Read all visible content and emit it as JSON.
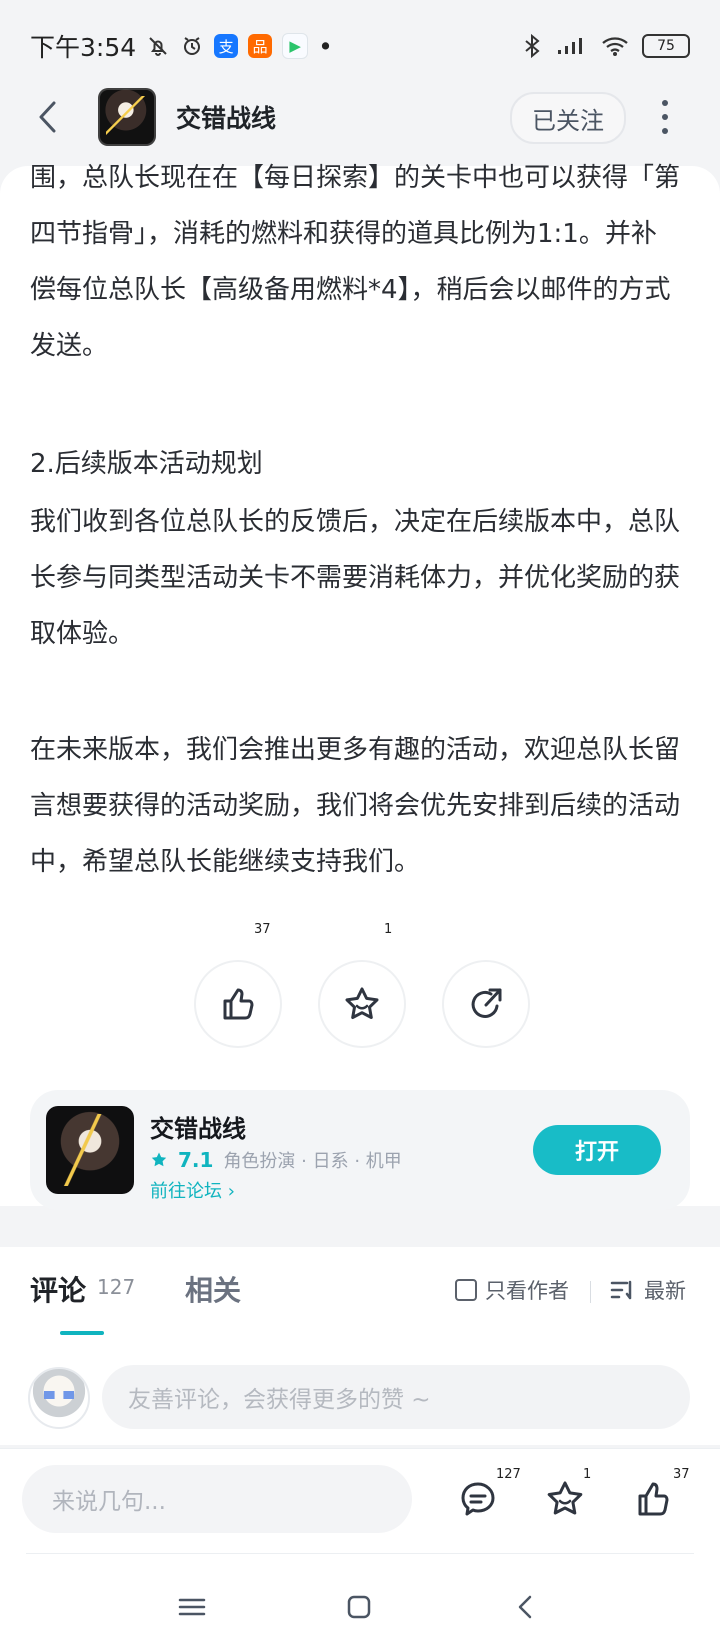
{
  "status": {
    "time": "下午3:54",
    "battery": "75",
    "app_icons": [
      "alipay-icon",
      "taobao-icon",
      "video-app-icon"
    ]
  },
  "header": {
    "title": "交错战线",
    "follow_label": "已关注"
  },
  "article": {
    "paragraph_1": "围，总队长现在在【每日探索】的关卡中也可以获得「第四节指骨」，消耗的燃料和获得的道具比例为1:1。并补偿每位总队长【高级备用燃料*4】，稍后会以邮件的方式发送。",
    "heading_2": "2.后续版本活动规划",
    "paragraph_2": "我们收到各位总队长的反馈后，决定在后续版本中，总队长参与同类型活动关卡不需要消耗体力，并优化奖励的获取体验。",
    "paragraph_3": "在未来版本，我们会推出更多有趣的活动，欢迎总队长留言想要获得的活动奖励，我们将会优先安排到后续的活动中，希望总队长能继续支持我们。"
  },
  "actions": {
    "like_count": "37",
    "favorite_count": "1"
  },
  "app_card": {
    "name": "交错战线",
    "rating": "7.1",
    "tags": "角色扮演 · 日系 · 机甲",
    "forum_link": "前往论坛",
    "open_label": "打开"
  },
  "comments": {
    "tab_comment": "评论",
    "comment_count": "127",
    "tab_related": "相关",
    "author_only_label": "只看作者",
    "sort_label": "最新",
    "input_placeholder": "友善评论，会获得更多的赞 ~"
  },
  "bottom_bar": {
    "input_placeholder": "来说几句...",
    "comment_count": "127",
    "favorite_count": "1",
    "like_count": "37"
  },
  "colors": {
    "accent": "#18bcc7",
    "background": "#f3f4f6",
    "text": "#2a2d33"
  }
}
